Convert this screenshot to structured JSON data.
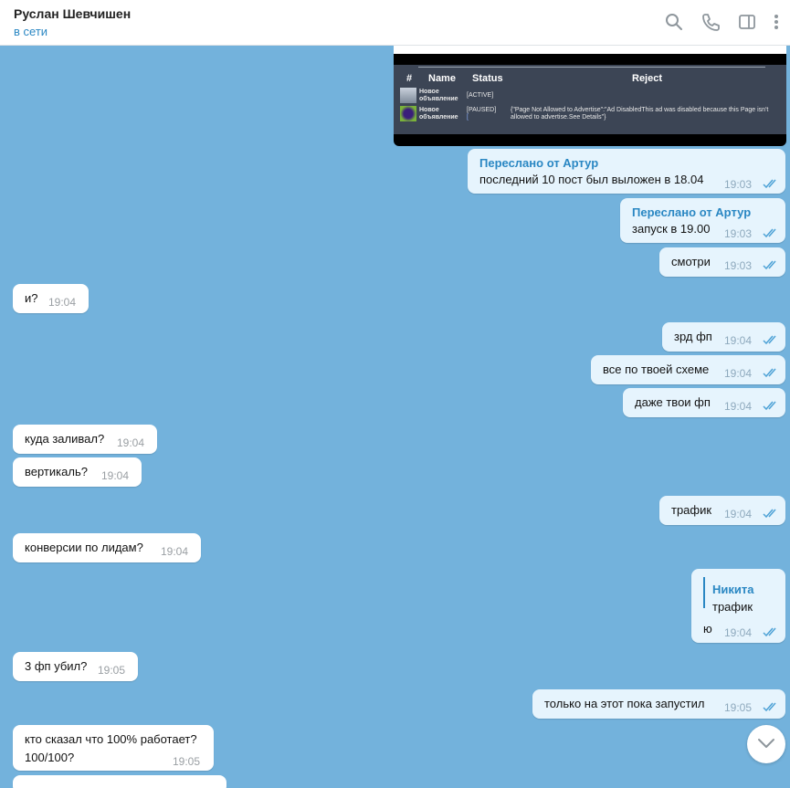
{
  "header": {
    "contact_name": "Руслан Шевчишен",
    "status": "в сети",
    "icons": [
      "search-icon",
      "phone-icon",
      "sidebar-toggle-icon",
      "more-icon"
    ]
  },
  "colors": {
    "background": "#73b2dc",
    "incoming_bubble": "#ffffff",
    "outgoing_bubble": "#e6f4fd",
    "accent": "#2a87c3",
    "read_checks": "#4ea2d6"
  },
  "image_message": {
    "columns": [
      "#",
      "Name",
      "Status",
      "Reject"
    ],
    "rows": [
      {
        "name_line1": "Новое",
        "name_line2": "объявление",
        "status": "[ACTIVE]",
        "reject": ""
      },
      {
        "name_line1": "Новое",
        "name_line2": "объявление",
        "status": "[PAUSED]",
        "status_link": "[",
        "reject_line1": "{\"Page Not Allowed to Advertise\":\"Ad DisabledThis ad was disabled because this Page isn't",
        "reject_line2": "allowed to advertise.See Details\"}"
      }
    ]
  },
  "messages": [
    {
      "direction": "out",
      "forwarded_from": "Переслано от Артур",
      "text": "последний 10 пост был выложен в 18.04",
      "time": "19:03"
    },
    {
      "direction": "out",
      "forwarded_from": "Переслано от Артур",
      "text": "запуск в 19.00",
      "time": "19:03"
    },
    {
      "direction": "out",
      "text": "смотри",
      "time": "19:03"
    },
    {
      "direction": "in",
      "text": "и?",
      "time": "19:04"
    },
    {
      "direction": "out",
      "text": "зрд фп",
      "time": "19:04"
    },
    {
      "direction": "out",
      "text": "все по твоей схеме",
      "time": "19:04"
    },
    {
      "direction": "out",
      "text": "даже твои фп",
      "time": "19:04"
    },
    {
      "direction": "in",
      "text": "куда заливал?",
      "time": "19:04"
    },
    {
      "direction": "in",
      "text": "вертикаль?",
      "time": "19:04"
    },
    {
      "direction": "out",
      "text": "трафик",
      "time": "19:04"
    },
    {
      "direction": "in",
      "text": "конверсии по лидам?",
      "time": "19:04"
    },
    {
      "direction": "out",
      "reply_author": "Никита",
      "reply_text": "трафик",
      "text": "ю",
      "time": "19:04"
    },
    {
      "direction": "in",
      "text": "3 фп убил?",
      "time": "19:05"
    },
    {
      "direction": "out",
      "text": "только на этот пока запустил",
      "time": "19:05"
    },
    {
      "direction": "in",
      "text_line1": "кто сказал что 100% работает?",
      "text_line2": "100/100?",
      "time": "19:05"
    }
  ]
}
